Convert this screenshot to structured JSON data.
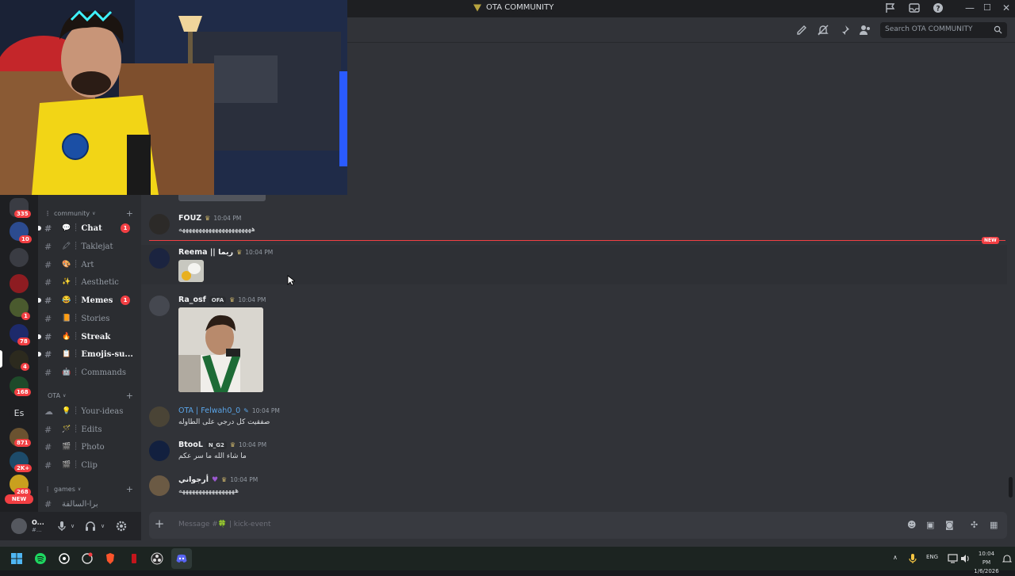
{
  "titlebar": {
    "title": "OTA COMMUNITY",
    "controls": [
      "minimize-icon",
      "maximize-icon",
      "close-icon"
    ]
  },
  "header": {
    "search_placeholder": "Search OTA COMMUNITY",
    "icons": [
      "threads-icon",
      "notifications-muted-icon",
      "pin-icon",
      "members-icon"
    ]
  },
  "servers": {
    "badges": [
      "335",
      "10",
      "1",
      "78",
      "4",
      "168",
      "871",
      "2K+",
      "268"
    ],
    "es_label": "Es",
    "new_label": "NEW"
  },
  "channels": {
    "categories": [
      {
        "label": "community"
      },
      {
        "label": "OTA"
      },
      {
        "label": "games"
      }
    ],
    "items": [
      {
        "name": "Chat",
        "emoji": "💬",
        "unread": true,
        "badge": "1"
      },
      {
        "name": "Taklejat",
        "emoji": "🖍",
        "unread": false,
        "badge": ""
      },
      {
        "name": "Art",
        "emoji": "🎨",
        "unread": false,
        "badge": ""
      },
      {
        "name": "Aesthetic",
        "emoji": "✨",
        "unread": false,
        "badge": ""
      },
      {
        "name": "Memes",
        "emoji": "😂",
        "unread": true,
        "badge": "1"
      },
      {
        "name": "Stories",
        "emoji": "📙",
        "unread": false,
        "badge": ""
      },
      {
        "name": "Streak",
        "emoji": "🔥",
        "unread": true,
        "badge": ""
      },
      {
        "name": "Emojis-su...",
        "emoji": "📋",
        "unread": true,
        "badge": ""
      },
      {
        "name": "Commands",
        "emoji": "🤖",
        "unread": false,
        "badge": ""
      },
      {
        "name": "Your-ideas",
        "emoji": "💡",
        "unread": false,
        "badge": ""
      },
      {
        "name": "Edits",
        "emoji": "🪄",
        "unread": false,
        "badge": ""
      },
      {
        "name": "Photo",
        "emoji": "🎬",
        "unread": false,
        "badge": ""
      },
      {
        "name": "Clip",
        "emoji": "🎬",
        "unread": false,
        "badge": ""
      },
      {
        "name": "برا-السالفة",
        "emoji": "",
        "unread": false,
        "badge": ""
      }
    ]
  },
  "user": {
    "name": "O...",
    "status": "#..."
  },
  "messages": [
    {
      "author": "FOUZ",
      "time": "10:04 PM",
      "text": "ههههههههههههههههههههههه",
      "role": ""
    },
    {
      "author": "Reema || ريما",
      "time": "10:04 PM",
      "text": "",
      "role": ""
    },
    {
      "author": "Ra_osf",
      "time": "10:04 PM",
      "text": "",
      "role": "OFA"
    },
    {
      "author": "OTA | Felwah0_0",
      "time": "10:04 PM",
      "text": "صفقيت كل درجي على الطاوله",
      "role": ""
    },
    {
      "author": "BtooL",
      "time": "10:04 PM",
      "text": "ما شاء الله ما سر عكم",
      "role": "N_G2"
    },
    {
      "author": "أرجواني",
      "time": "10:04 PM",
      "text": "هههههههههههههههههه",
      "role": ""
    }
  ],
  "new_divider_label": "NEW",
  "composer": {
    "placeholder": "Message #🍀 | kick-event"
  },
  "taskbar": {
    "lang": "ENG",
    "time": "10:04 PM",
    "date": "1/6/2026"
  },
  "colors": {
    "accent": "#5865f2",
    "unread_badge": "#f23f43",
    "link_author": "#5aa5e8"
  }
}
